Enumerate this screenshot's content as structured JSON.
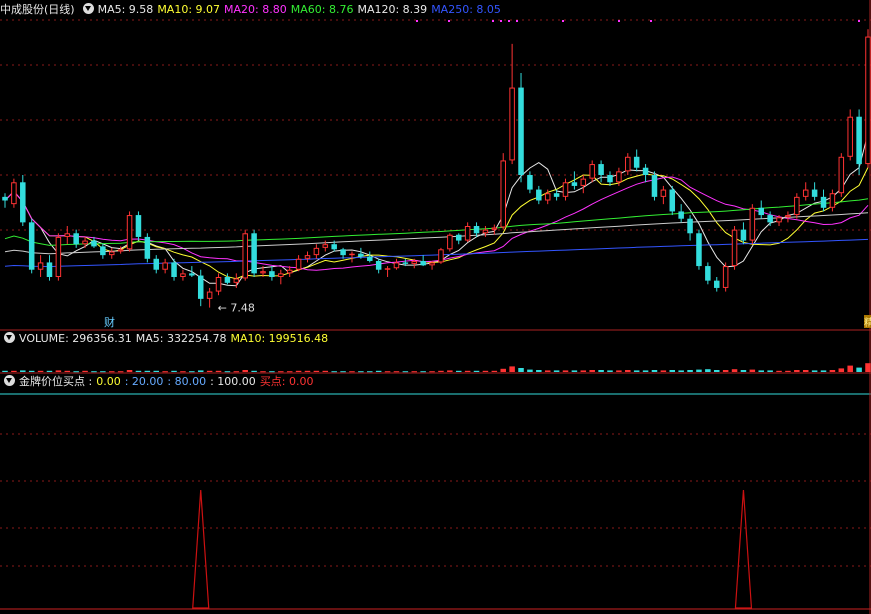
{
  "header": {
    "title": "中成股份(日线)",
    "ma_items": [
      {
        "label": "MA5: 9.58",
        "color": "#e8e8e8"
      },
      {
        "label": "MA10: 9.07",
        "color": "#ffff33"
      },
      {
        "label": "MA20: 8.80",
        "color": "#ff33ff"
      },
      {
        "label": "MA60: 8.76",
        "color": "#33ee33"
      },
      {
        "label": "MA120: 8.39",
        "color": "#e8e8e8"
      },
      {
        "label": "MA250: 8.05",
        "color": "#3355ff"
      }
    ]
  },
  "volume_legend": {
    "volume": "VOLUME: 296356.31",
    "ma5": "MA5: 332254.78",
    "ma10": "MA10: 199516.48"
  },
  "indicator_legend": {
    "name": "金牌价位买点 :",
    "v1": "0.00",
    "v2": ": 20.00",
    "v3": ": 80.00",
    "v4": ": 100.00",
    "buy_label": "买点: 0.00"
  },
  "annotations": {
    "low_marker": "7.48",
    "cai_tag": "财",
    "right_tag": "精"
  },
  "colors": {
    "up": "#ff3333",
    "down": "#33dddd",
    "grid": "#8a1a1a",
    "ma5": "#e8e8e8",
    "ma10": "#ffff33",
    "ma20": "#ff33ff",
    "ma60": "#33ee33",
    "ma120": "#cccccc",
    "ma250": "#3355ff",
    "signal": "#cc1111"
  },
  "chart_data": {
    "type": "candlestick",
    "price_range": [
      7.2,
      11.4
    ],
    "grid": true,
    "candles": [
      [
        9.0,
        9.05,
        8.85,
        8.95
      ],
      [
        8.9,
        9.25,
        8.85,
        9.2
      ],
      [
        9.2,
        9.3,
        8.6,
        8.65
      ],
      [
        8.65,
        8.7,
        7.95,
        8.0
      ],
      [
        8.0,
        8.2,
        7.9,
        8.1
      ],
      [
        8.1,
        8.2,
        7.85,
        7.9
      ],
      [
        7.9,
        8.5,
        7.85,
        8.45
      ],
      [
        8.45,
        8.6,
        8.35,
        8.5
      ],
      [
        8.5,
        8.55,
        8.3,
        8.35
      ],
      [
        8.35,
        8.45,
        8.3,
        8.4
      ],
      [
        8.4,
        8.45,
        8.3,
        8.32
      ],
      [
        8.32,
        8.36,
        8.15,
        8.2
      ],
      [
        8.2,
        8.3,
        8.15,
        8.25
      ],
      [
        8.25,
        8.32,
        8.22,
        8.28
      ],
      [
        8.28,
        8.8,
        8.25,
        8.75
      ],
      [
        8.75,
        8.8,
        8.4,
        8.45
      ],
      [
        8.45,
        8.5,
        8.1,
        8.15
      ],
      [
        8.15,
        8.2,
        7.95,
        8.0
      ],
      [
        8.0,
        8.15,
        7.95,
        8.1
      ],
      [
        8.1,
        8.15,
        7.85,
        7.9
      ],
      [
        7.9,
        8.0,
        7.85,
        7.95
      ],
      [
        7.95,
        8.05,
        7.9,
        7.92
      ],
      [
        7.92,
        8.0,
        7.5,
        7.6
      ],
      [
        7.6,
        7.75,
        7.48,
        7.7
      ],
      [
        7.7,
        7.95,
        7.65,
        7.9
      ],
      [
        7.9,
        7.95,
        7.8,
        7.82
      ],
      [
        7.82,
        7.95,
        7.75,
        7.88
      ],
      [
        7.88,
        8.55,
        7.85,
        8.5
      ],
      [
        8.5,
        8.55,
        7.9,
        7.95
      ],
      [
        7.95,
        8.05,
        7.9,
        7.98
      ],
      [
        7.98,
        8.05,
        7.85,
        7.9
      ],
      [
        7.9,
        8.0,
        7.8,
        7.95
      ],
      [
        7.95,
        8.05,
        7.9,
        8.0
      ],
      [
        8.0,
        8.2,
        7.98,
        8.15
      ],
      [
        8.15,
        8.25,
        8.1,
        8.2
      ],
      [
        8.2,
        8.35,
        8.15,
        8.3
      ],
      [
        8.3,
        8.4,
        8.25,
        8.35
      ],
      [
        8.35,
        8.4,
        8.25,
        8.28
      ],
      [
        8.28,
        8.3,
        8.15,
        8.2
      ],
      [
        8.2,
        8.25,
        8.1,
        8.22
      ],
      [
        8.22,
        8.3,
        8.15,
        8.18
      ],
      [
        8.18,
        8.25,
        8.1,
        8.12
      ],
      [
        8.12,
        8.15,
        7.95,
        8.0
      ],
      [
        8.0,
        8.05,
        7.9,
        8.02
      ],
      [
        8.02,
        8.15,
        8.0,
        8.1
      ],
      [
        8.1,
        8.15,
        8.05,
        8.08
      ],
      [
        8.08,
        8.15,
        8.02,
        8.12
      ],
      [
        8.12,
        8.2,
        8.05,
        8.06
      ],
      [
        8.06,
        8.12,
        8.0,
        8.1
      ],
      [
        8.1,
        8.3,
        8.08,
        8.28
      ],
      [
        8.28,
        8.5,
        8.25,
        8.48
      ],
      [
        8.48,
        8.5,
        8.35,
        8.4
      ],
      [
        8.4,
        8.65,
        8.38,
        8.6
      ],
      [
        8.6,
        8.65,
        8.45,
        8.5
      ],
      [
        8.5,
        8.6,
        8.45,
        8.55
      ],
      [
        8.55,
        8.62,
        8.48,
        8.58
      ],
      [
        8.58,
        9.6,
        8.55,
        9.5
      ],
      [
        9.5,
        11.1,
        9.45,
        10.5
      ],
      [
        10.5,
        10.7,
        9.2,
        9.3
      ],
      [
        9.3,
        9.35,
        9.05,
        9.1
      ],
      [
        9.1,
        9.15,
        8.9,
        8.95
      ],
      [
        8.95,
        9.1,
        8.9,
        9.05
      ],
      [
        9.05,
        9.1,
        8.95,
        9.0
      ],
      [
        9.0,
        9.25,
        8.95,
        9.2
      ],
      [
        9.2,
        9.35,
        9.1,
        9.15
      ],
      [
        9.15,
        9.3,
        9.05,
        9.25
      ],
      [
        9.25,
        9.5,
        9.2,
        9.45
      ],
      [
        9.45,
        9.5,
        9.2,
        9.3
      ],
      [
        9.3,
        9.35,
        9.15,
        9.2
      ],
      [
        9.2,
        9.4,
        9.15,
        9.35
      ],
      [
        9.35,
        9.6,
        9.3,
        9.55
      ],
      [
        9.55,
        9.65,
        9.35,
        9.4
      ],
      [
        9.4,
        9.45,
        9.2,
        9.3
      ],
      [
        9.3,
        9.35,
        8.95,
        9.0
      ],
      [
        9.0,
        9.15,
        8.9,
        9.1
      ],
      [
        9.1,
        9.15,
        8.75,
        8.8
      ],
      [
        8.8,
        8.9,
        8.65,
        8.7
      ],
      [
        8.7,
        8.75,
        8.4,
        8.5
      ],
      [
        8.5,
        8.55,
        8.0,
        8.05
      ],
      [
        8.05,
        8.1,
        7.8,
        7.85
      ],
      [
        7.85,
        7.9,
        7.7,
        7.75
      ],
      [
        7.75,
        8.1,
        7.7,
        8.05
      ],
      [
        8.05,
        8.6,
        8.0,
        8.55
      ],
      [
        8.55,
        8.65,
        8.35,
        8.4
      ],
      [
        8.4,
        8.9,
        8.35,
        8.85
      ],
      [
        8.85,
        8.95,
        8.7,
        8.75
      ],
      [
        8.75,
        8.8,
        8.6,
        8.65
      ],
      [
        8.65,
        8.75,
        8.6,
        8.72
      ],
      [
        8.72,
        8.8,
        8.65,
        8.75
      ],
      [
        8.75,
        9.05,
        8.7,
        9.0
      ],
      [
        9.0,
        9.2,
        8.95,
        9.1
      ],
      [
        9.1,
        9.2,
        8.95,
        9.0
      ],
      [
        9.0,
        9.1,
        8.8,
        8.85
      ],
      [
        8.85,
        9.1,
        8.8,
        9.05
      ],
      [
        9.05,
        9.6,
        9.0,
        9.55
      ],
      [
        9.55,
        10.2,
        9.5,
        10.1
      ],
      [
        10.1,
        10.2,
        9.3,
        9.45
      ],
      [
        9.45,
        11.3,
        9.4,
        11.2
      ]
    ],
    "ma_periods": [
      5,
      10,
      20,
      60,
      120,
      250
    ],
    "volume": {
      "values": [
        3,
        3,
        4,
        3,
        3,
        3,
        4,
        3,
        2,
        3,
        2,
        2,
        2,
        2,
        5,
        3,
        3,
        3,
        2,
        3,
        2,
        2,
        4,
        3,
        3,
        2,
        2,
        5,
        3,
        2,
        2,
        2,
        2,
        3,
        3,
        3,
        3,
        2,
        2,
        2,
        2,
        2,
        3,
        2,
        2,
        2,
        2,
        2,
        2,
        3,
        4,
        3,
        3,
        3,
        3,
        3,
        8,
        14,
        10,
        6,
        5,
        4,
        4,
        4,
        4,
        4,
        5,
        5,
        4,
        4,
        5,
        4,
        4,
        5,
        4,
        5,
        4,
        5,
        6,
        7,
        5,
        5,
        7,
        5,
        6,
        4,
        4,
        3,
        3,
        5,
        5,
        4,
        4,
        5,
        9,
        16,
        11,
        22
      ],
      "range": [
        0,
        60
      ]
    },
    "indicator": {
      "levels": [
        0,
        20,
        80,
        100
      ],
      "signal_indices": [
        22,
        83
      ],
      "range": [
        0,
        100
      ]
    }
  }
}
